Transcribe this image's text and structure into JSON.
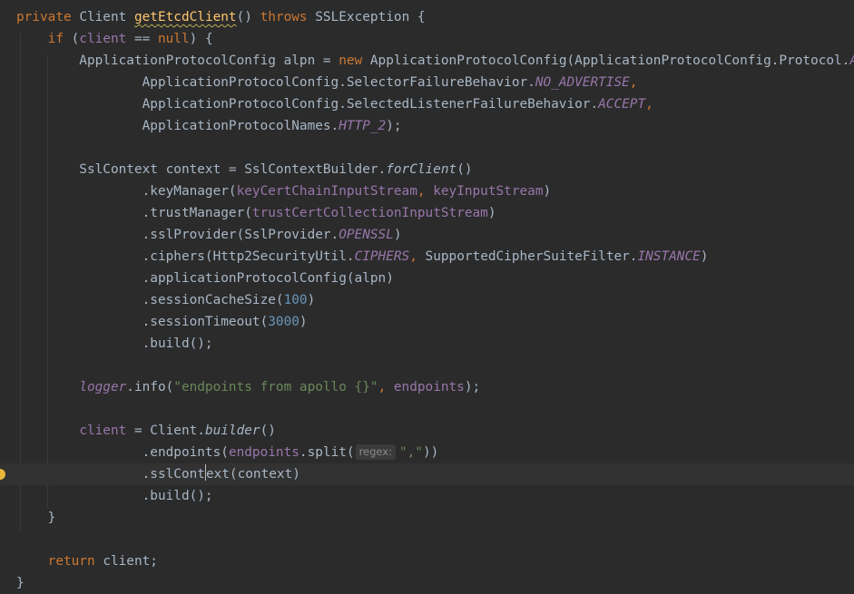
{
  "editor": {
    "language": "java",
    "current_line": 21,
    "lines": [
      [
        [
          "private ",
          "kw"
        ],
        [
          "Client ",
          ""
        ],
        [
          "getEtcdClient",
          "fn squig"
        ],
        [
          "() ",
          ""
        ],
        [
          "throws ",
          "kw"
        ],
        [
          "SSLException {",
          ""
        ]
      ],
      [
        [
          "    ",
          ""
        ],
        [
          "if ",
          "kw"
        ],
        [
          "(",
          ""
        ],
        [
          "client ",
          "field"
        ],
        [
          "== ",
          ""
        ],
        [
          "null",
          "kw"
        ],
        [
          ") {",
          ""
        ]
      ],
      [
        [
          "        ApplicationProtocolConfig alpn = ",
          ""
        ],
        [
          "new ",
          "kw"
        ],
        [
          "ApplicationProtocolConfig(ApplicationProtocolConfig.Protocol.",
          ""
        ],
        [
          "ALPN",
          "const"
        ],
        [
          ",",
          "kw"
        ]
      ],
      [
        [
          "                ApplicationProtocolConfig.SelectorFailureBehavior.",
          ""
        ],
        [
          "NO_ADVERTISE",
          "const"
        ],
        [
          ",",
          "kw"
        ]
      ],
      [
        [
          "                ApplicationProtocolConfig.SelectedListenerFailureBehavior.",
          ""
        ],
        [
          "ACCEPT",
          "const"
        ],
        [
          ",",
          "kw"
        ]
      ],
      [
        [
          "                ApplicationProtocolNames.",
          ""
        ],
        [
          "HTTP_2",
          "const"
        ],
        [
          ");",
          ""
        ]
      ],
      [],
      [
        [
          "        SslContext context = SslContextBuilder.",
          ""
        ],
        [
          "forClient",
          "it"
        ],
        [
          "()",
          ""
        ]
      ],
      [
        [
          "                .keyManager(",
          ""
        ],
        [
          "keyCertChainInputStream",
          "field"
        ],
        [
          ", ",
          "kw"
        ],
        [
          "keyInputStream",
          "field"
        ],
        [
          ")",
          ""
        ]
      ],
      [
        [
          "                .trustManager(",
          ""
        ],
        [
          "trustCertCollectionInputStream",
          "field"
        ],
        [
          ")",
          ""
        ]
      ],
      [
        [
          "                .sslProvider(SslProvider.",
          ""
        ],
        [
          "OPENSSL",
          "const"
        ],
        [
          ")",
          ""
        ]
      ],
      [
        [
          "                .ciphers(Http2SecurityUtil.",
          ""
        ],
        [
          "CIPHERS",
          "const"
        ],
        [
          ", ",
          "kw"
        ],
        [
          "SupportedCipherSuiteFilter.",
          ""
        ],
        [
          "INSTANCE",
          "const"
        ],
        [
          ")",
          ""
        ]
      ],
      [
        [
          "                .applicationProtocolConfig(alpn)",
          ""
        ]
      ],
      [
        [
          "                .sessionCacheSize(",
          ""
        ],
        [
          "100",
          "num"
        ],
        [
          ")",
          ""
        ]
      ],
      [
        [
          "                .sessionTimeout(",
          ""
        ],
        [
          "3000",
          "num"
        ],
        [
          ")",
          ""
        ]
      ],
      [
        [
          "                .build();",
          ""
        ]
      ],
      [],
      [
        [
          "        ",
          ""
        ],
        [
          "logger",
          "const"
        ],
        [
          ".info(",
          ""
        ],
        [
          "\"endpoints from apollo {}\"",
          "str"
        ],
        [
          ", ",
          "kw"
        ],
        [
          "endpoints",
          "field"
        ],
        [
          ");",
          ""
        ]
      ],
      [],
      [
        [
          "        ",
          ""
        ],
        [
          "client ",
          "field"
        ],
        [
          "= Client.",
          ""
        ],
        [
          "builder",
          "it"
        ],
        [
          "()",
          ""
        ]
      ],
      [
        [
          "                .endpoints(",
          ""
        ],
        [
          "endpoints",
          "field"
        ],
        [
          ".split(",
          ""
        ],
        [
          "regex:",
          "hint"
        ],
        [
          "\",\"",
          "str"
        ],
        [
          "))",
          ""
        ]
      ],
      [
        [
          "                .sslCont",
          ""
        ],
        [
          "",
          "caret"
        ],
        [
          "ext(context)",
          ""
        ]
      ],
      [
        [
          "                .build();",
          ""
        ]
      ],
      [
        [
          "    }",
          ""
        ]
      ],
      [],
      [
        [
          "    ",
          ""
        ],
        [
          "return ",
          "kw"
        ],
        [
          "client;",
          ""
        ]
      ],
      [
        [
          "}",
          ""
        ]
      ]
    ]
  }
}
